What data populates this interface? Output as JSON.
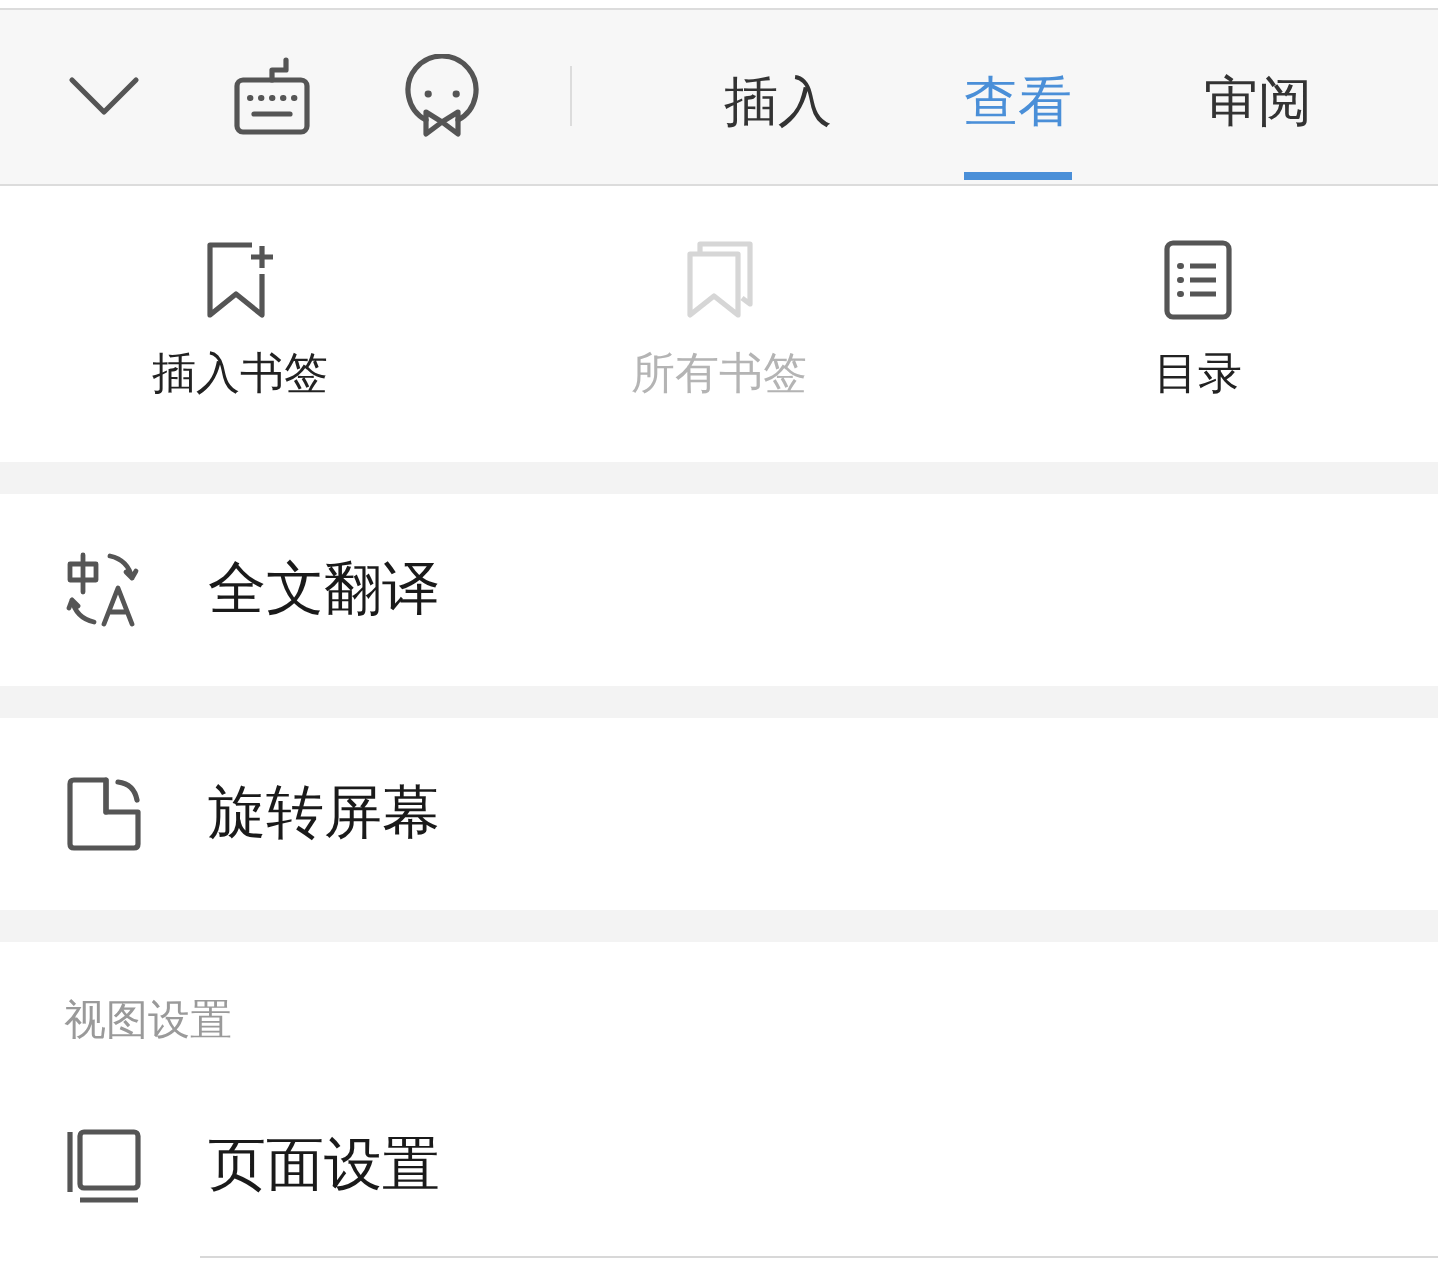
{
  "tabs": [
    {
      "label": "插入",
      "selected": false
    },
    {
      "label": "查看",
      "selected": true
    },
    {
      "label": "审阅",
      "selected": false
    }
  ],
  "tools": [
    {
      "label": "插入书签",
      "kind": "bookmark-add",
      "disabled": false
    },
    {
      "label": "所有书签",
      "kind": "bookmarks",
      "disabled": true
    },
    {
      "label": "目录",
      "kind": "toc",
      "disabled": false
    }
  ],
  "actions": [
    {
      "label": "全文翻译",
      "kind": "translate"
    },
    {
      "label": "旋转屏幕",
      "kind": "rotate"
    }
  ],
  "view_settings": {
    "heading": "视图设置",
    "items": [
      {
        "label": "页面设置",
        "kind": "page"
      }
    ]
  }
}
